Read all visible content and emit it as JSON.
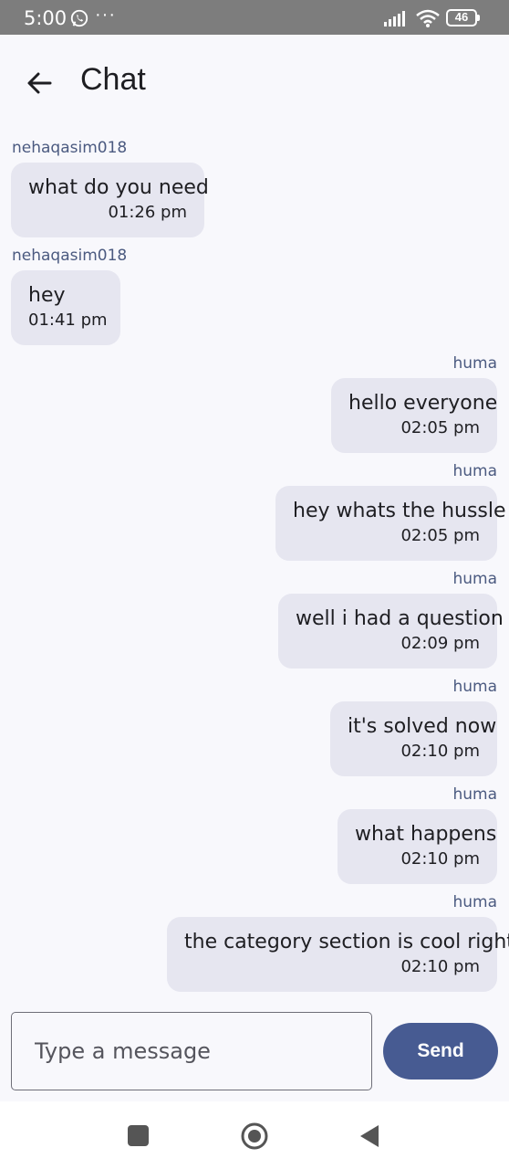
{
  "status_bar": {
    "time": "5:00",
    "icons": [
      "whatsapp-icon",
      "more-dots-icon",
      "signal-icon",
      "wifi-icon",
      "battery-icon"
    ],
    "dots": "···",
    "battery": "46"
  },
  "app_bar": {
    "back_icon": "arrow-left-icon",
    "title": "Chat"
  },
  "messages": [
    {
      "sender": "nehaqasim018",
      "text": "what do you need",
      "time": "01:26 pm",
      "direction": "incoming"
    },
    {
      "sender": "nehaqasim018",
      "text": "hey",
      "time": "01:41 pm",
      "direction": "incoming"
    },
    {
      "sender": "huma",
      "text": "hello everyone",
      "time": "02:05 pm",
      "direction": "outgoing"
    },
    {
      "sender": "huma",
      "text": "hey whats the hussle",
      "time": "02:05 pm",
      "direction": "outgoing"
    },
    {
      "sender": "huma",
      "text": "well i had a question",
      "time": "02:09 pm",
      "direction": "outgoing"
    },
    {
      "sender": "huma",
      "text": "it's solved now",
      "time": "02:10 pm",
      "direction": "outgoing"
    },
    {
      "sender": "huma",
      "text": "what happens",
      "time": "02:10 pm",
      "direction": "outgoing"
    },
    {
      "sender": "huma",
      "text": "the category section is cool right",
      "time": "02:10 pm",
      "direction": "outgoing"
    }
  ],
  "composer": {
    "placeholder": "Type a message",
    "value": "",
    "send_label": "Send"
  },
  "nav_bar": {
    "icons": [
      "recents-square-icon",
      "home-circle-icon",
      "back-triangle-icon"
    ]
  },
  "colors": {
    "accent": "#475b92",
    "bubble": "#e6e6f0",
    "sender": "#4b5a80",
    "background": "#f8f8fc",
    "status_bar": "#7d7d7d"
  }
}
